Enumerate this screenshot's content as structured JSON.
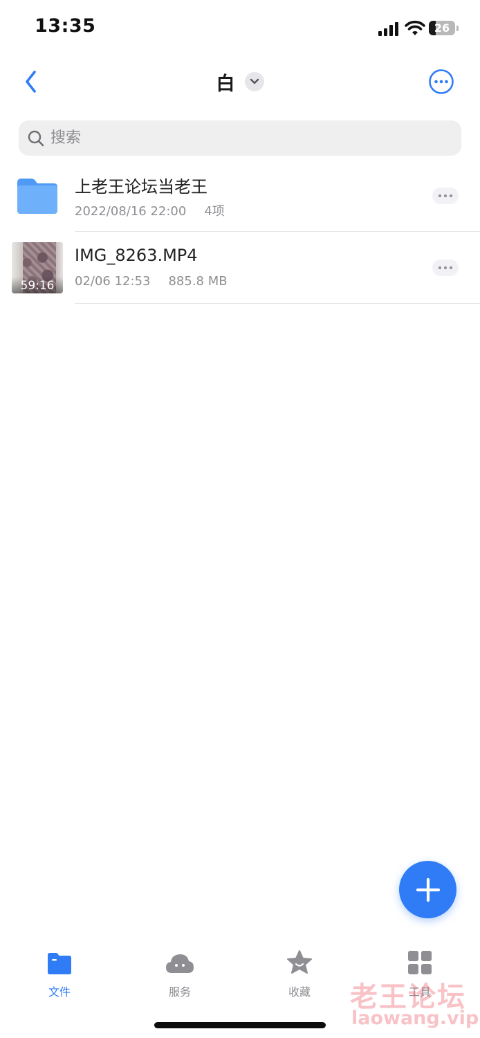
{
  "status_bar": {
    "time": "13:35",
    "battery_level": "26",
    "battery_fraction": 0.26
  },
  "nav": {
    "title": "白"
  },
  "search": {
    "placeholder": "搜索"
  },
  "files": [
    {
      "name": "上老王论坛当老王",
      "date": "2022/08/16 22:00",
      "detail": "4项",
      "kind": "folder",
      "icon": "folder-icon"
    },
    {
      "name": "IMG_8263.MP4",
      "date": "02/06 12:53",
      "detail": "885.8 MB",
      "duration": "59:16",
      "kind": "video",
      "icon": "video-thumbnail"
    }
  ],
  "tabs": [
    {
      "label": "文件",
      "icon": "folder-icon",
      "active": true
    },
    {
      "label": "服务",
      "icon": "cloud-icon",
      "active": false
    },
    {
      "label": "收藏",
      "icon": "star-icon",
      "active": false
    },
    {
      "label": "工具",
      "icon": "grid-icon",
      "active": false
    }
  ],
  "watermark": {
    "text": "老王论坛",
    "url": "laowang.vip"
  },
  "colors": {
    "accent": "#2f7cf6",
    "folder": "#5aa2f7",
    "inactive": "#8e8e93",
    "watermark": "#e84050"
  }
}
